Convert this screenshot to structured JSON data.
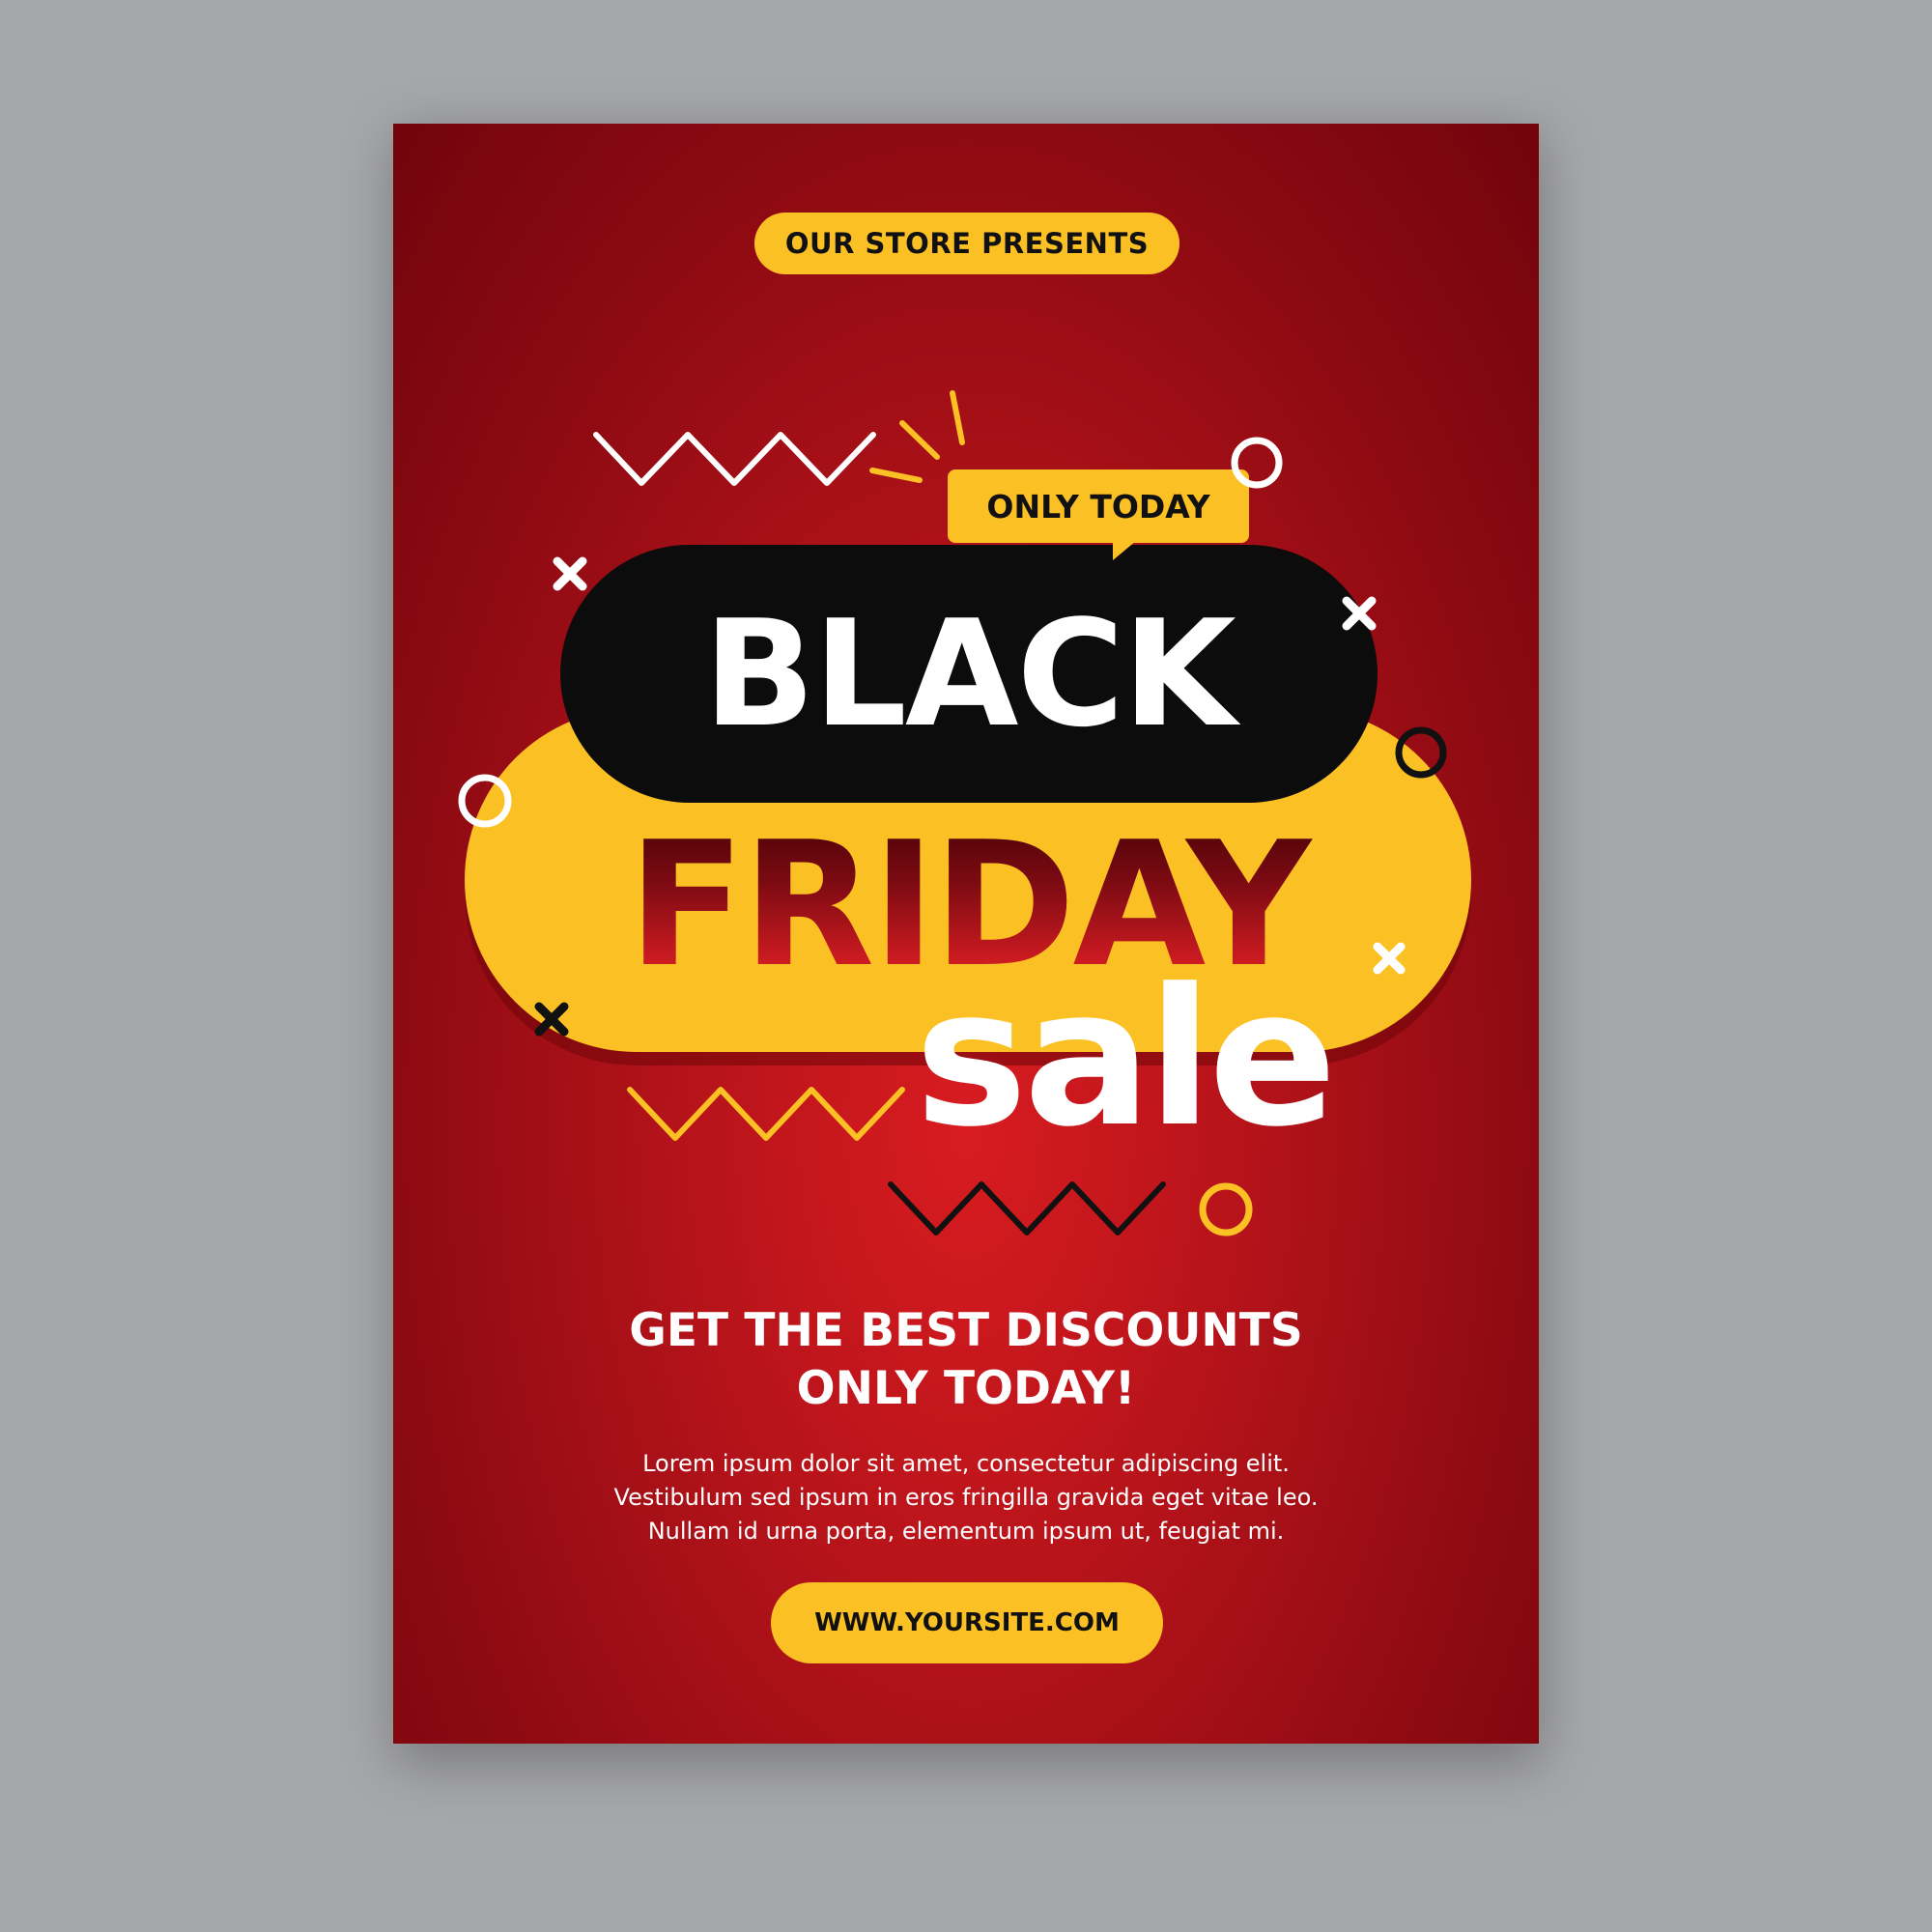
{
  "poster": {
    "tagline": "OUR STORE PRESENTS",
    "badge": "ONLY TODAY",
    "title_line1": "BLACK",
    "title_line2": "FRIDAY",
    "title_line3": "sale",
    "headline_lines": [
      "GET THE BEST DISCOUNTS",
      "ONLY TODAY!"
    ],
    "body_lines": [
      "Lorem ipsum dolor sit amet, consectetur adipiscing elit.",
      "Vestibulum sed ipsum in eros fringilla gravida eget vitae leo.",
      "Nullam id urna porta, elementum ipsum ut, feugiat mi."
    ],
    "website": "WWW.YOURSITE.COM"
  },
  "colors": {
    "background": "#a6a7a9",
    "poster_red": "#b5131a",
    "accent_yellow": "#fbc024",
    "black": "#0c0c0c",
    "white": "#ffffff"
  },
  "decorations": [
    "zigzag-white",
    "zigzag-yellow",
    "zigzag-black",
    "circle-white",
    "circle-black",
    "circle-yellow",
    "cross-white",
    "cross-black",
    "burst-lines-yellow"
  ]
}
